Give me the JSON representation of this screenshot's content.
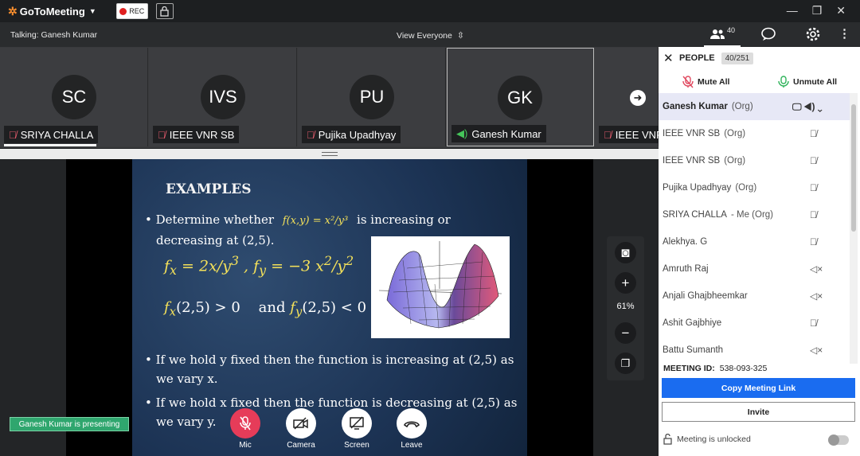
{
  "app": {
    "title": "GoToMeeting",
    "rec_label": "REC"
  },
  "talking": "Talking: Ganesh Kumar",
  "view": "View Everyone",
  "people_count": "40",
  "tiles": [
    {
      "initials": "SC",
      "name": "SRIYA CHALLA",
      "mic": "muted"
    },
    {
      "initials": "IVS",
      "name": "IEEE VNR SB",
      "mic": "muted"
    },
    {
      "initials": "PU",
      "name": "Pujika Upadhyay",
      "mic": "muted"
    },
    {
      "initials": "GK",
      "name": "Ganesh Kumar",
      "mic": "speaking"
    },
    {
      "initials": "",
      "name": "IEEE VNR",
      "mic": "muted"
    }
  ],
  "slide": {
    "heading": "EXAMPLES",
    "bullet1a": "• Determine whether",
    "bullet1b": "is increasing or",
    "bullet1c": "decreasing at (2,5).",
    "bullet2a": "• If we hold y fixed then the function is increasing at (2,5) as",
    "bullet2b": "we vary x.",
    "bullet3a": "• If we hold x fixed then the function is decreasing at (2,5) as",
    "bullet3b": "we vary y."
  },
  "zoom": "61%",
  "presenting": "Ganesh Kumar is presenting",
  "controls": {
    "mic": "Mic",
    "camera": "Camera",
    "screen": "Screen",
    "leave": "Leave"
  },
  "panel": {
    "title": "PEOPLE",
    "count": "40/251",
    "mute_all": "Mute All",
    "unmute_all": "Unmute All",
    "people": [
      {
        "name": "Ganesh Kumar",
        "org": "(Org)",
        "status": "presenter"
      },
      {
        "name": "IEEE VNR SB",
        "org": "(Org)",
        "status": "muted"
      },
      {
        "name": "IEEE VNR SB",
        "org": "(Org)",
        "status": "muted"
      },
      {
        "name": "Pujika Upadhyay",
        "org": "(Org)",
        "status": "muted"
      },
      {
        "name": "SRIYA CHALLA",
        "org": "- Me (Org)",
        "status": "muted"
      },
      {
        "name": "Alekhya. G",
        "org": "",
        "status": "muted"
      },
      {
        "name": "Amruth Raj",
        "org": "",
        "status": "speaker-off"
      },
      {
        "name": "Anjali Ghajbheemkar",
        "org": "",
        "status": "speaker-off"
      },
      {
        "name": "Ashit Gajbhiye",
        "org": "",
        "status": "muted"
      },
      {
        "name": "Battu Sumanth",
        "org": "",
        "status": "speaker-off"
      }
    ],
    "meeting_id_label": "MEETING ID:",
    "meeting_id": "538-093-325",
    "copy_link": "Copy Meeting Link",
    "invite": "Invite",
    "lock_text": "Meeting is unlocked"
  }
}
